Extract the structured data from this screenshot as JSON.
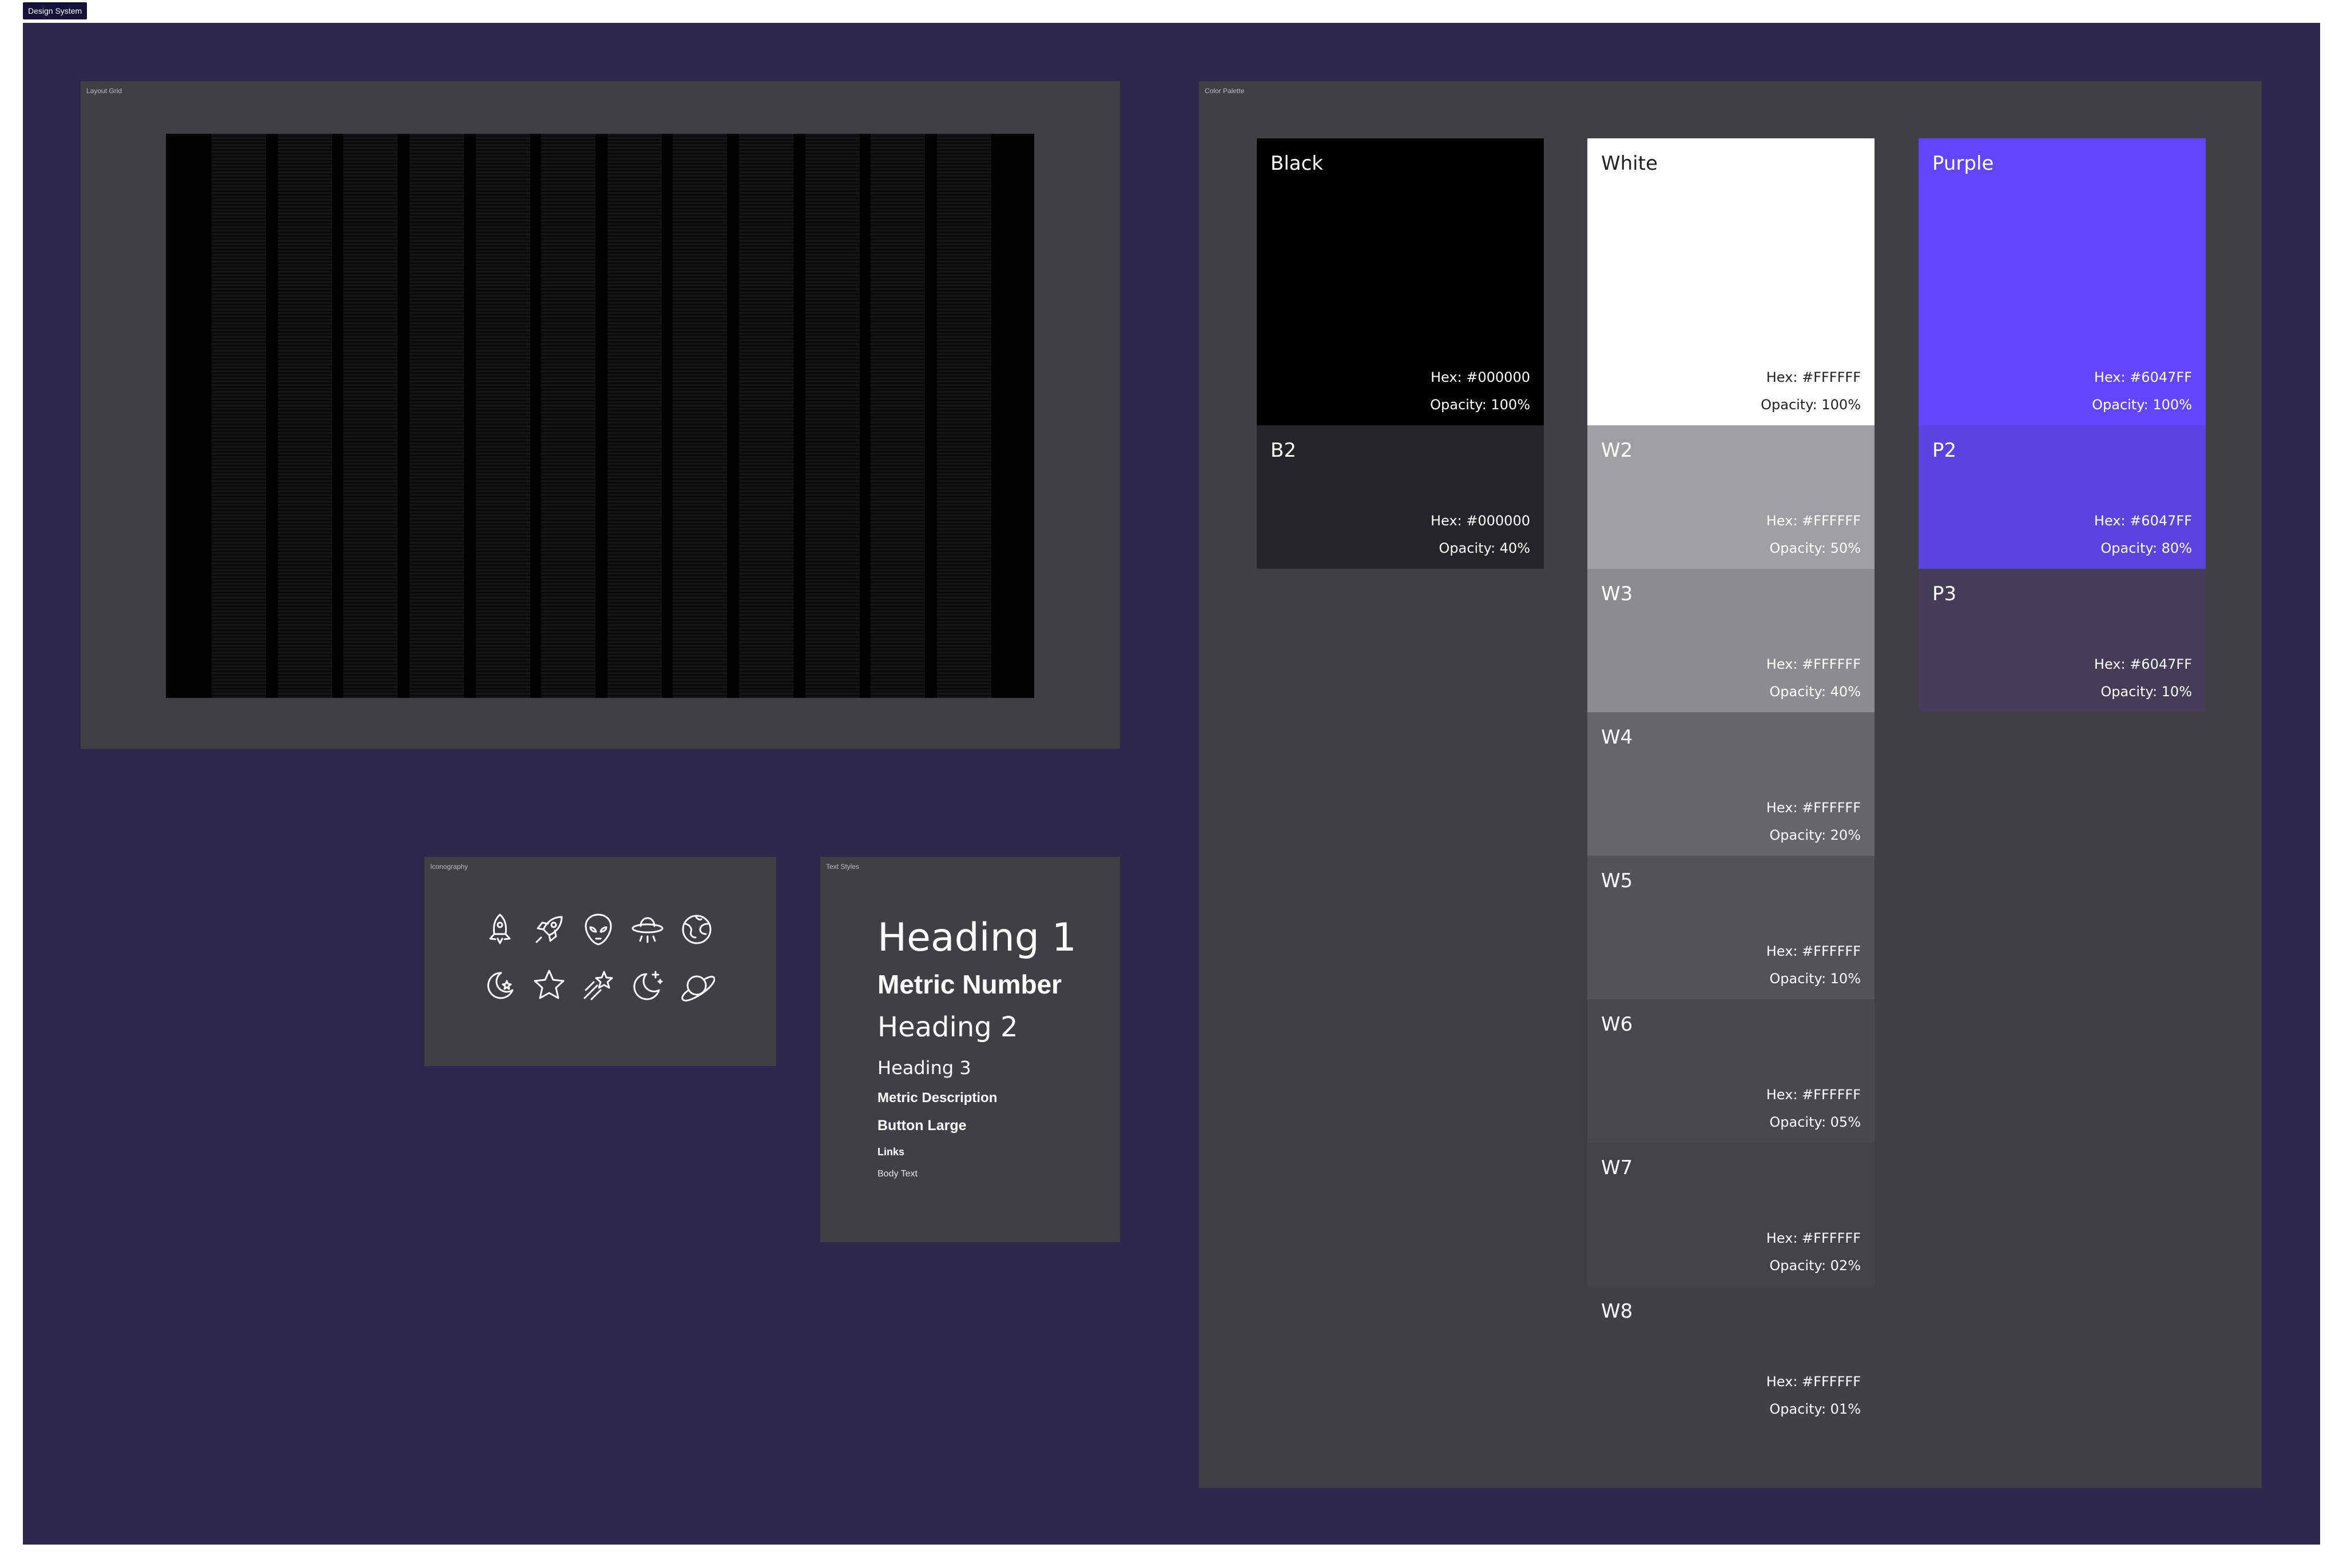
{
  "canvas_tag": "Design System",
  "layout_grid": {
    "label": "Layout Grid"
  },
  "color_palette": {
    "label": "Color Palette",
    "swatches": {
      "black": {
        "name": "Black",
        "hex": "Hex: #000000",
        "opacity": "Opacity: 100%",
        "color": "#000000"
      },
      "b2": {
        "name": "B2",
        "hex": "Hex: #000000",
        "opacity": "Opacity: 40%",
        "color": "#252427"
      },
      "white": {
        "name": "White",
        "hex": "Hex: #FFFFFF",
        "opacity": "Opacity: 100%",
        "color": "#FFFFFF"
      },
      "w2": {
        "name": "W2",
        "hex": "Hex: #FFFFFF",
        "opacity": "Opacity: 50%",
        "color": "#9F9EA1"
      },
      "w3": {
        "name": "W3",
        "hex": "Hex: #FFFFFF",
        "opacity": "Opacity: 40%",
        "color": "#8C8B8E"
      },
      "w4": {
        "name": "W4",
        "hex": "Hex: #FFFFFF",
        "opacity": "Opacity: 20%",
        "color": "#666569"
      },
      "w5": {
        "name": "W5",
        "hex": "Hex: #FFFFFF",
        "opacity": "Opacity: 10%",
        "color": "#535256"
      },
      "w6": {
        "name": "W6",
        "hex": "Hex: #FFFFFF",
        "opacity": "Opacity: 05%",
        "color": "#49484C"
      },
      "w7": {
        "name": "W7",
        "hex": "Hex: #FFFFFF",
        "opacity": "Opacity: 02%",
        "color": "#434246"
      },
      "w8": {
        "name": "W8",
        "hex": "Hex: #FFFFFF",
        "opacity": "Opacity: 01%",
        "color": "#414044"
      },
      "purple": {
        "name": "Purple",
        "hex": "Hex: #6047FF",
        "opacity": "Opacity: 100%",
        "color": "#6047FF"
      },
      "p2": {
        "name": "P2",
        "hex": "Hex: #6047FF",
        "opacity": "Opacity: 80%",
        "color": "#5A44DF"
      },
      "p3": {
        "name": "P3",
        "hex": "Hex: #6047FF",
        "opacity": "Opacity: 10%",
        "color": "#433D58"
      }
    }
  },
  "iconography": {
    "label": "Iconography",
    "icons": [
      "rocket-icon",
      "rocket-launch-icon",
      "alien-icon",
      "ufo-icon",
      "globe-icon",
      "moon-star-icon",
      "star-icon",
      "shooting-star-icon",
      "moon-sparkle-icon",
      "planet-icon"
    ]
  },
  "text_styles": {
    "label": "Text Styles",
    "heading1": "Heading 1",
    "metric_number": "Metric Number",
    "heading2": "Heading 2",
    "heading3": "Heading 3",
    "metric_description": "Metric Description",
    "button_large": "Button Large",
    "links": "Links",
    "body_text": "Body Text"
  },
  "colors": {
    "canvas": "#2D274D",
    "frame": "#403F43",
    "accent": "#6047FF"
  }
}
